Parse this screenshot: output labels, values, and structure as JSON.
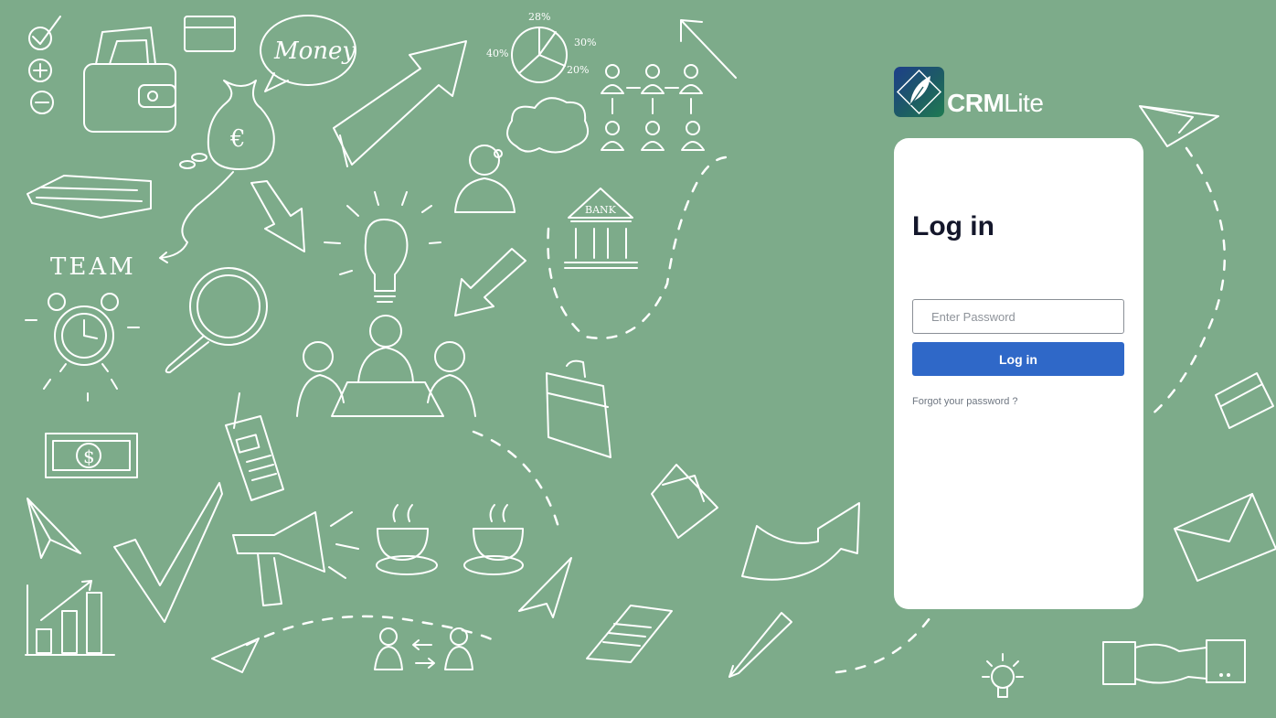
{
  "brand": {
    "name_bold": "CRM",
    "name_light": "Lite",
    "logo_icon": "feather-quill-icon",
    "logo_gradient": [
      "#1d3e8a",
      "#1f7a52"
    ]
  },
  "login": {
    "title": "Log in",
    "password_placeholder": "Enter Password",
    "submit_label": "Log in",
    "forgot_link": "Forgot your password ?"
  },
  "doodles": {
    "money_text": "Money",
    "team_text": "TEAM",
    "bank_text": "BANK",
    "pie_labels": [
      "28%",
      "30%",
      "40%",
      "20%"
    ],
    "euro_sign": "€",
    "dollar_sign": "$"
  },
  "colors": {
    "background": "#7dab8a",
    "card": "#ffffff",
    "button": "#2f68c8",
    "title": "#14172b"
  }
}
